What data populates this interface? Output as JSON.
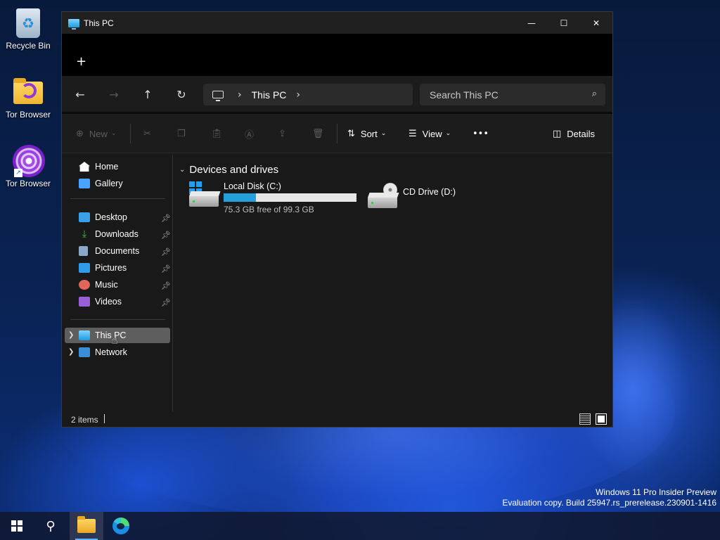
{
  "desktop": {
    "icons": [
      {
        "label": "Recycle Bin"
      },
      {
        "label": "Tor Browser"
      },
      {
        "label": "Tor Browser"
      }
    ],
    "watermark_line1": "Windows 11 Pro Insider Preview",
    "watermark_line2": "Evaluation copy. Build 25947.rs_prerelease.230901-1416"
  },
  "window": {
    "title": "This PC",
    "controls": {
      "minimize": "—",
      "maximize": "☐",
      "close": "✕"
    },
    "new_tab": "+",
    "nav": {
      "back": "←",
      "forward": "→",
      "up": "↑",
      "refresh": "↻"
    },
    "address": {
      "crumb": "This PC",
      "chevron": "›"
    },
    "search": {
      "placeholder": "Search This PC",
      "icon": "⌕"
    },
    "toolbar": {
      "new_label": "New",
      "sort_label": "Sort",
      "view_label": "View",
      "more_label": "•••",
      "details_label": "Details"
    },
    "sidebar": {
      "items": [
        {
          "label": "Home",
          "icon": "home-icon",
          "color": "#ffffff"
        },
        {
          "label": "Gallery",
          "icon": "gallery-icon",
          "color": "#4aa3ff"
        },
        {
          "label": "Desktop",
          "icon": "desktop-icon",
          "color": "#3aa0e8",
          "pinned": true
        },
        {
          "label": "Downloads",
          "icon": "download-icon",
          "color": "#3dbb63",
          "pinned": true
        },
        {
          "label": "Documents",
          "icon": "documents-icon",
          "color": "#8aa9c8",
          "pinned": true
        },
        {
          "label": "Pictures",
          "icon": "pictures-icon",
          "color": "#2f9bea",
          "pinned": true
        },
        {
          "label": "Music",
          "icon": "music-icon",
          "color": "#e2675b",
          "pinned": true
        },
        {
          "label": "Videos",
          "icon": "videos-icon",
          "color": "#9a5fd6",
          "pinned": true
        },
        {
          "label": "This PC",
          "icon": "computer-icon",
          "color": "#2fa8e6",
          "selected": true
        },
        {
          "label": "Network",
          "icon": "network-icon",
          "color": "#3a8fd8"
        }
      ]
    },
    "content": {
      "group_title": "Devices and drives",
      "drives": [
        {
          "name": "Local Disk (C:)",
          "free_text": "75.3 GB free of 99.3 GB",
          "used_fraction": 0.242
        },
        {
          "name": "CD Drive (D:)"
        }
      ]
    },
    "status": {
      "items_text": "2 items"
    }
  },
  "taskbar": {
    "items": [
      "start",
      "search",
      "file-explorer",
      "edge"
    ],
    "search_glyph": "⚲"
  }
}
